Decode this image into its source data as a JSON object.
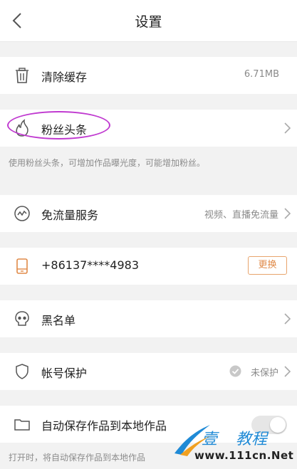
{
  "header": {
    "title": "设置"
  },
  "rows": {
    "clear_cache": {
      "label": "清除缓存",
      "value": "6.71MB"
    },
    "fans_headline": {
      "label": "粉丝头条"
    },
    "fans_hint": "使用粉丝头条，可增加作品曝光度，可能增加粉丝。",
    "free_data": {
      "label": "免流量服务",
      "value": "视频、直播免流量"
    },
    "phone": {
      "number": "+86137****4983",
      "button": "更换"
    },
    "blacklist": {
      "label": "黑名单"
    },
    "account_protect": {
      "label": "帐号保护",
      "value": "未保护"
    },
    "auto_save": {
      "label": "自动保存作品到本地作品"
    },
    "auto_save_hint": "打开时，将自动保存作品到本地作品"
  },
  "watermark": {
    "char1": "壹",
    "char2": "教程",
    "url": "www.111cn.Net"
  },
  "colors": {
    "accent_orange": "#e08a48",
    "annotation_purple": "#c03ad0"
  }
}
